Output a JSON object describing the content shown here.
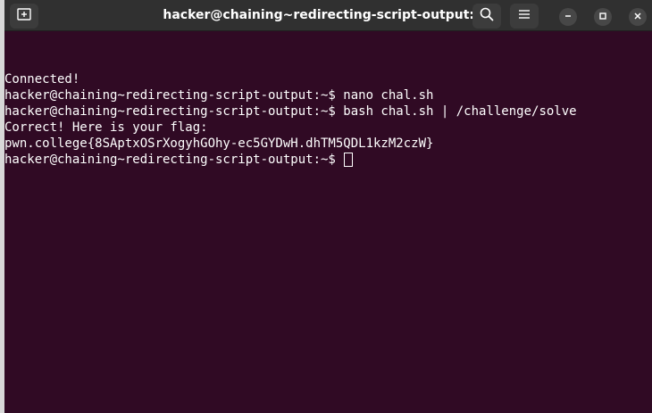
{
  "window": {
    "title": "hacker@chaining~redirecting-script-output: ~"
  },
  "icons": {
    "new_tab": "new-tab-icon",
    "search": "search-icon",
    "menu": "hamburger-menu-icon",
    "minimize": "minimize-icon",
    "maximize": "maximize-icon",
    "close": "close-icon"
  },
  "terminal": {
    "lines": [
      "Connected!",
      "hacker@chaining~redirecting-script-output:~$ nano chal.sh",
      "hacker@chaining~redirecting-script-output:~$ bash chal.sh | /challenge/solve",
      "Correct! Here is your flag:",
      "pwn.college{8SAptxOSrXogyhGOhy-ec5GYDwH.dhTM5QDL1kzM2czW}"
    ],
    "prompt": "hacker@chaining~redirecting-script-output:~$ "
  },
  "colors": {
    "terminal_bg": "#300a24",
    "titlebar_bg": "#303030",
    "text": "#ffffff"
  }
}
